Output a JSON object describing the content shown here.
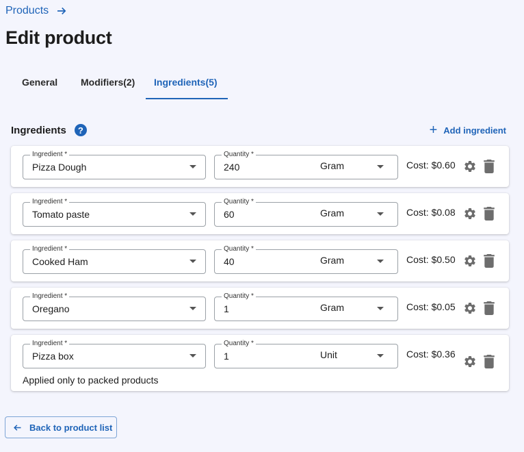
{
  "breadcrumb": {
    "label": "Products"
  },
  "page": {
    "title": "Edit product"
  },
  "tabs": [
    {
      "label": "General"
    },
    {
      "label": "Modifiers(2)"
    },
    {
      "label": "Ingredients(5)",
      "active": true
    }
  ],
  "section": {
    "title": "Ingredients",
    "help": "?",
    "add_label": "Add ingredient"
  },
  "field_labels": {
    "ingredient": "Ingredient *",
    "quantity": "Quantity *"
  },
  "ingredients": [
    {
      "name": "Pizza Dough",
      "quantity": "240",
      "unit": "Gram",
      "cost": "Cost: $0.60"
    },
    {
      "name": "Tomato paste",
      "quantity": "60",
      "unit": "Gram",
      "cost": "Cost: $0.08"
    },
    {
      "name": "Cooked Ham",
      "quantity": "40",
      "unit": "Gram",
      "cost": "Cost: $0.50"
    },
    {
      "name": "Oregano",
      "quantity": "1",
      "unit": "Gram",
      "cost": "Cost: $0.05"
    },
    {
      "name": "Pizza box",
      "quantity": "1",
      "unit": "Unit",
      "cost": "Cost: $0.36",
      "note": "Applied only to packed products"
    }
  ],
  "footer": {
    "back_label": "Back to product list"
  },
  "colors": {
    "accent": "#1f64b8",
    "background": "#f4f5fd",
    "icon": "#6d6d6d"
  }
}
